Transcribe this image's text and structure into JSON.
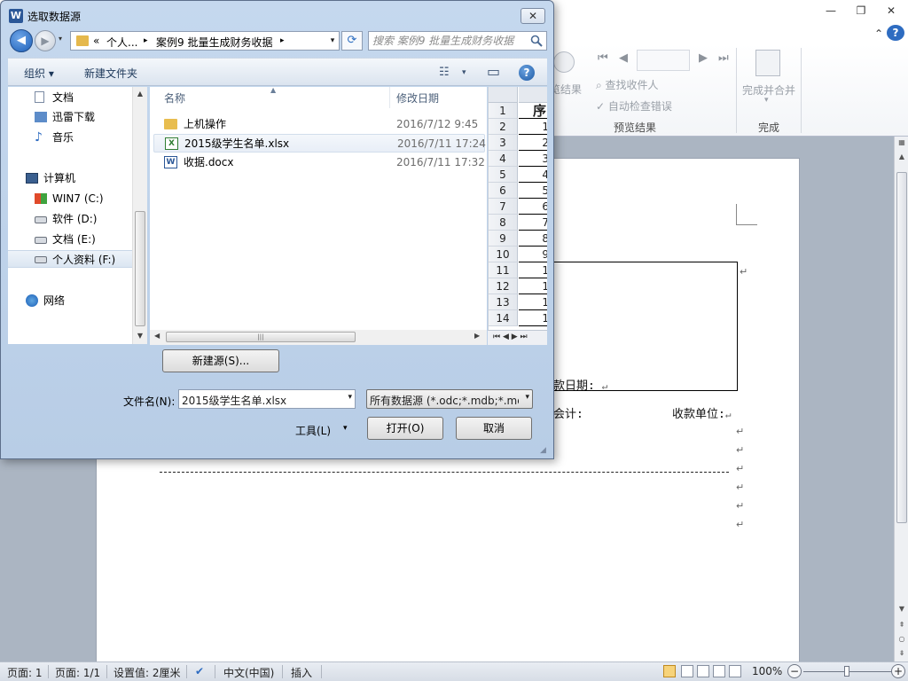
{
  "word": {
    "window_controls": {
      "minimize": "—",
      "restore": "❐",
      "close": "✕"
    },
    "ribbon_collapse": "⌃",
    "help": "?",
    "ribbon": {
      "preview_result_label_tail": "览结果",
      "find_recipient": "查找收件人",
      "auto_check_errors": "自动检查错误",
      "group_preview": "预览结果",
      "finish_merge": "完成并合并",
      "finish_merge_arrow": "▾",
      "group_finish": "完成",
      "nav": {
        "first": "⏮",
        "prev": "◀",
        "next": "▶",
        "last": "⏭"
      }
    },
    "document": {
      "date_label": "款日期:",
      "accounting_label": "会计:",
      "payee_label": "收款单位:",
      "para_mark": "↵"
    },
    "status": {
      "page": "页面: 1",
      "pages": "页面: 1/1",
      "setting": "设置值: 2厘米",
      "language": "中文(中国)",
      "insert": "插入",
      "zoom": "100%",
      "zoom_minus": "−",
      "zoom_plus": "+"
    }
  },
  "dialog": {
    "title_icon": "W",
    "title": "选取数据源",
    "close": "✕",
    "nav_back": "◀",
    "nav_forward": "▶",
    "nav_history": "▾",
    "breadcrumb": {
      "prefix": "«",
      "segments": [
        "个人...",
        "案例9 批量生成财务收据"
      ],
      "separator": "▸",
      "dropdown": "▾"
    },
    "refresh": "⟳",
    "search_placeholder": "搜索 案例9 批量生成财务收据",
    "toolbar": {
      "organize": "组织 ▾",
      "new_folder": "新建文件夹",
      "view_icon": "☷",
      "view_dropdown": "▾",
      "pane_icon": "▭",
      "help": "?"
    },
    "nav_items": [
      {
        "label": "文档",
        "icon": "documents-icon"
      },
      {
        "label": "迅雷下载",
        "icon": "folder-download-icon"
      },
      {
        "label": "音乐",
        "icon": "music-icon"
      },
      {
        "label": "计算机",
        "icon": "computer-icon"
      },
      {
        "label": "WIN7 (C:)",
        "icon": "windows-drive-icon"
      },
      {
        "label": "软件 (D:)",
        "icon": "drive-icon"
      },
      {
        "label": "文档 (E:)",
        "icon": "drive-icon"
      },
      {
        "label": "个人资料 (F:)",
        "icon": "drive-icon"
      },
      {
        "label": "网络",
        "icon": "network-icon"
      }
    ],
    "columns": {
      "name": "名称",
      "modified": "修改日期"
    },
    "files": [
      {
        "name": "上机操作",
        "date": "2016/7/12 9:45",
        "type": "folder"
      },
      {
        "name": "2015级学生名单.xlsx",
        "date": "2016/7/11 17:24",
        "type": "excel"
      },
      {
        "name": "收据.docx",
        "date": "2016/7/11 17:32",
        "type": "word"
      }
    ],
    "preview": {
      "header_cell": "序",
      "rows": [
        {
          "n": "1",
          "v": ""
        },
        {
          "n": "2",
          "v": "1"
        },
        {
          "n": "3",
          "v": "2"
        },
        {
          "n": "4",
          "v": "3"
        },
        {
          "n": "5",
          "v": "4"
        },
        {
          "n": "6",
          "v": "5"
        },
        {
          "n": "7",
          "v": "6"
        },
        {
          "n": "8",
          "v": "7"
        },
        {
          "n": "9",
          "v": "8"
        },
        {
          "n": "10",
          "v": "9"
        },
        {
          "n": "11",
          "v": "1"
        },
        {
          "n": "12",
          "v": "1"
        },
        {
          "n": "13",
          "v": "1"
        },
        {
          "n": "14",
          "v": "1"
        }
      ],
      "tab_nav": "⏮ ◀ ▶ ⏭"
    },
    "new_source_button": "新建源(S)...",
    "filename_label": "文件名(N):",
    "filename_value": "2015级学生名单.xlsx",
    "filter_value": "所有数据源 (*.odc;*.mdb;*.md",
    "combo_arrow": "▾",
    "tools_label": "工具(L)",
    "tools_arrow": "▾",
    "open_button": "打开(O)",
    "cancel_button": "取消"
  }
}
